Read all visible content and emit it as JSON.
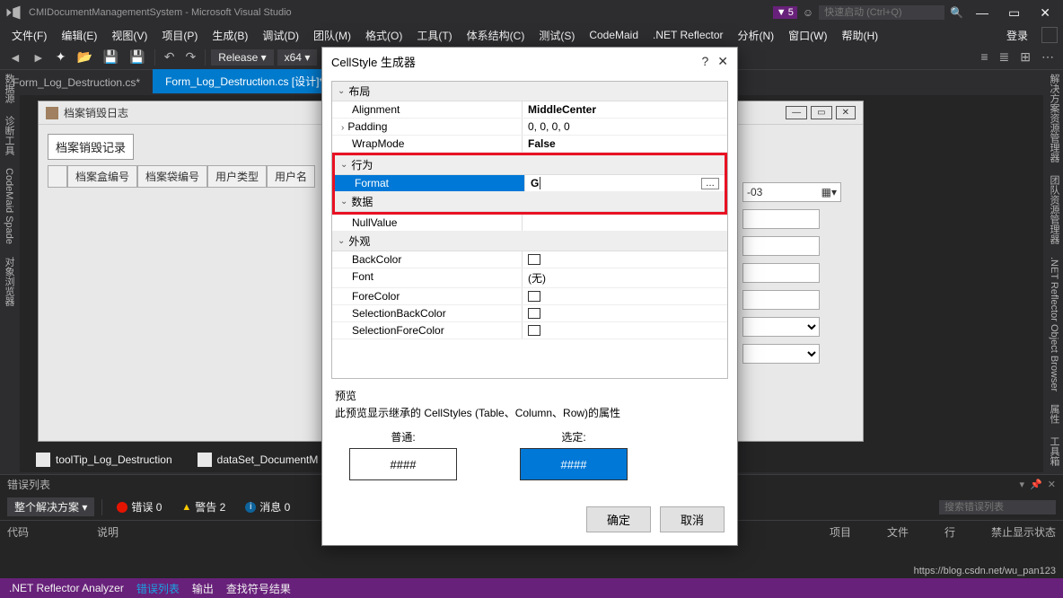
{
  "window": {
    "title": "CMIDocumentManagementSystem - Microsoft Visual Studio",
    "badge_count": "5",
    "quick_launch_placeholder": "快速启动 (Ctrl+Q)"
  },
  "menu": {
    "items": [
      "文件(F)",
      "编辑(E)",
      "视图(V)",
      "项目(P)",
      "生成(B)",
      "调试(D)",
      "团队(M)",
      "格式(O)",
      "工具(T)",
      "体系结构(C)",
      "测试(S)",
      "CodeMaid",
      ".NET Reflector",
      "分析(N)",
      "窗口(W)",
      "帮助(H)"
    ],
    "login": "登录"
  },
  "toolbar": {
    "config": "Release",
    "platform": "x64"
  },
  "tabs": {
    "a": "Form_Log_Destruction.cs*",
    "b": "Form_Log_Destruction.cs [设计]*"
  },
  "left_rail": [
    "数据源",
    "诊断工具",
    "CodeMaid Spade",
    "对象浏览器"
  ],
  "right_rail": [
    "解决方案资源管理器",
    "团队资源管理器",
    ".NET Reflector Object Browser",
    "属性",
    "工具箱"
  ],
  "designer": {
    "form_title": "档案销毁日志",
    "record_label": "档案销毁记录",
    "columns": [
      "档案盒编号",
      "档案袋编号",
      "用户类型",
      "用户名"
    ],
    "date_value": "-03"
  },
  "tray": {
    "a": "toolTip_Log_Destruction",
    "b": "dataSet_DocumentM"
  },
  "error_panel": {
    "title": "错误列表",
    "scope": "整个解决方案",
    "errors": "错误 0",
    "warnings": "警告 2",
    "messages": "消息 0",
    "search_placeholder": "搜索错误列表",
    "columns": {
      "code": "代码",
      "desc": "说明",
      "project": "项目",
      "file": "文件",
      "line": "行",
      "suppress": "禁止显示状态"
    }
  },
  "status": {
    "items": [
      ".NET Reflector Analyzer",
      "错误列表",
      "输出",
      "查找符号结果"
    ]
  },
  "dialog": {
    "title": "CellStyle 生成器",
    "cat_layout": "布局",
    "cat_behavior": "行为",
    "cat_data": "数据",
    "cat_appearance": "外观",
    "p_alignment": "Alignment",
    "v_alignment": "MiddleCenter",
    "p_padding": "Padding",
    "v_padding": "0, 0, 0, 0",
    "p_wrapmode": "WrapMode",
    "v_wrapmode": "False",
    "p_format": "Format",
    "v_format": "G",
    "p_nullvalue": "NullValue",
    "p_backcolor": "BackColor",
    "p_font": "Font",
    "v_font": "(无)",
    "p_forecolor": "ForeColor",
    "p_selbackcolor": "SelectionBackColor",
    "p_selforecolor": "SelectionForeColor",
    "preview_label": "预览",
    "preview_text": "此预览显示继承的 CellStyles (Table、Column、Row)的属性",
    "normal_label": "普通:",
    "selected_label": "选定:",
    "sample": "####",
    "ok": "确定",
    "cancel": "取消"
  },
  "footer_url": "https://blog.csdn.net/wu_pan123"
}
